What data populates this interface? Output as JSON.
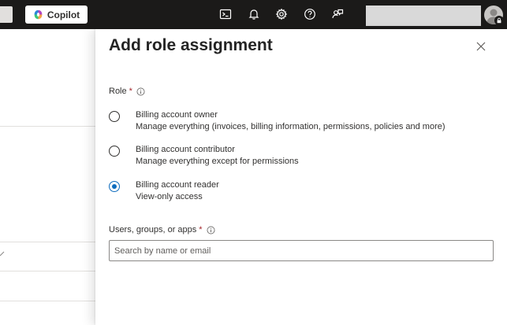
{
  "topbar": {
    "copilot_label": "Copilot",
    "icons": [
      "cloud-shell-icon",
      "notifications-icon",
      "settings-icon",
      "help-icon",
      "feedback-icon"
    ],
    "account_name": ""
  },
  "panel": {
    "title": "Add role assignment",
    "role_label": "Role",
    "required_mark": "*",
    "roles": [
      {
        "title": "Billing account owner",
        "description": "Manage everything (invoices, billing information, permissions, policies and more)",
        "selected": false
      },
      {
        "title": "Billing account contributor",
        "description": "Manage everything except for permissions",
        "selected": false
      },
      {
        "title": "Billing account reader",
        "description": "View-only access",
        "selected": true
      }
    ],
    "principals_label": "Users, groups, or apps",
    "search_placeholder": "Search by name or email",
    "search_value": ""
  },
  "colors": {
    "topbar_bg": "#1b1a19",
    "accent": "#0f6cbd",
    "required": "#a4262c"
  }
}
